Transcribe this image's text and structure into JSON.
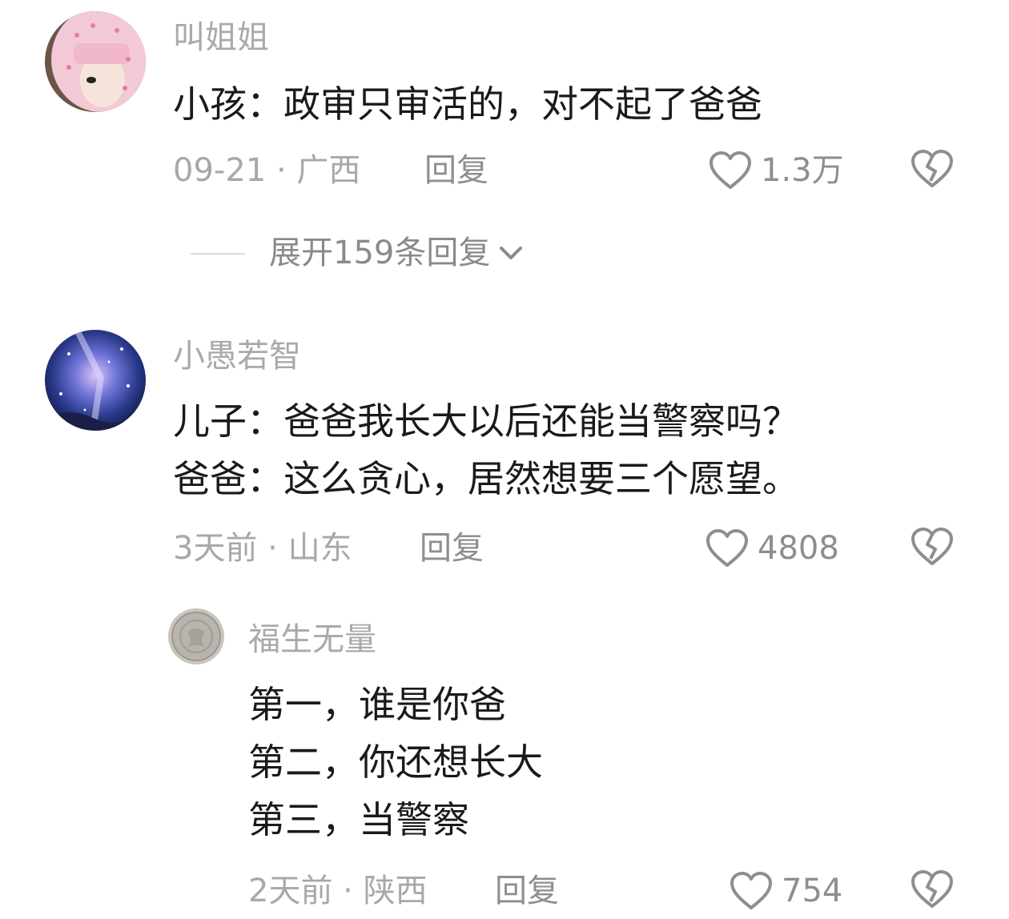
{
  "comments": [
    {
      "username": "叫姐姐",
      "lines": [
        "小孩：政审只审活的，对不起了爸爸"
      ],
      "meta": "09-21 · 广西",
      "reply": "回复",
      "likes": "1.3万",
      "avatar_icon": "girl-photo-avatar"
    },
    {
      "username": "小愚若智",
      "lines": [
        "儿子：爸爸我长大以后还能当警察吗？",
        "爸爸：这么贪心，居然想要三个愿望。"
      ],
      "meta": "3天前 · 山东",
      "reply": "回复",
      "likes": "4808",
      "avatar_icon": "galaxy-avatar"
    }
  ],
  "expand_replies": {
    "label": "展开159条回复",
    "icon": "chevron-down-icon"
  },
  "sub_reply": {
    "username": "福生无量",
    "lines": [
      "第一，谁是你爸",
      "第二，你还想长大",
      "第三，当警察"
    ],
    "meta": "2天前 · 陕西",
    "reply": "回复",
    "likes": "754",
    "avatar_icon": "coin-avatar"
  },
  "icons": {
    "like": "heart-outline-icon",
    "dislike": "broken-heart-icon"
  },
  "colors": {
    "text": "#1a1a1a",
    "muted": "#a8a8a8",
    "icon": "#8e8e8e",
    "background": "#ffffff"
  }
}
